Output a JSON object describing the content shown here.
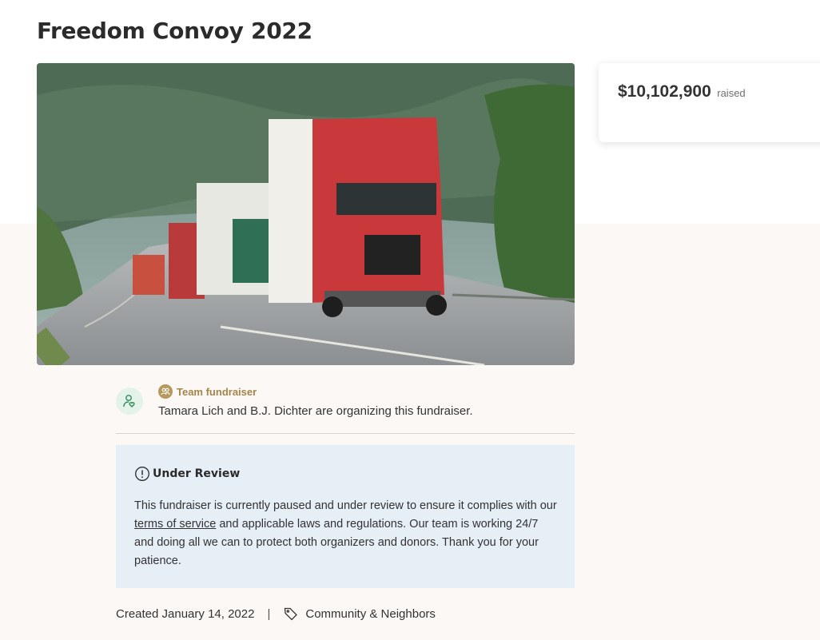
{
  "page": {
    "title": "Freedom Convoy 2022"
  },
  "donation": {
    "amount": "$10,102,900",
    "label": "raised"
  },
  "organizer": {
    "badge_icon": "people-icon",
    "team_label": "Team fundraiser",
    "text": "Tamara Lich and B.J. Dichter are organizing this fundraiser."
  },
  "review": {
    "title": "Under Review",
    "body_before": "This fundraiser is currently paused and under review to ensure it complies with our ",
    "terms_link": "terms of service",
    "body_after": " and applicable laws and regulations. Our team is working 24/7 and doing all we can to protect both organizers and donors. Thank you for your patience."
  },
  "meta": {
    "created": "Created January 14, 2022",
    "separator": "|",
    "category": "Community & Neighbors"
  },
  "colors": {
    "accent_gold": "#a5854a",
    "review_bg": "#e6eef6",
    "avatar_green": "#2f8a5c",
    "page_band": "#fbf8f6"
  }
}
